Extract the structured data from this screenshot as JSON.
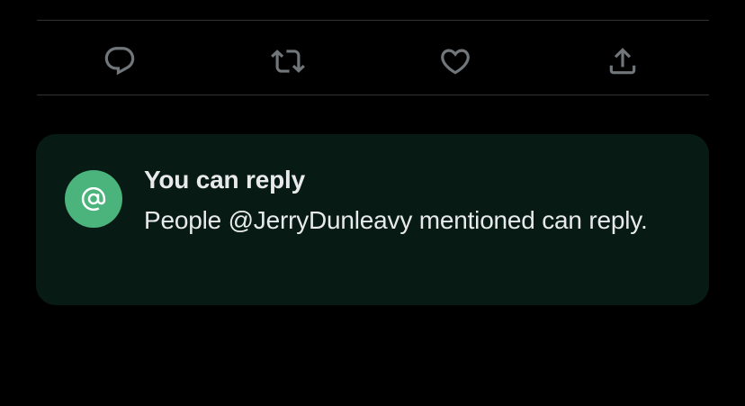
{
  "actions": {
    "reply_icon": "speech-bubble-icon",
    "retweet_icon": "retweet-icon",
    "like_icon": "heart-icon",
    "share_icon": "share-upload-icon"
  },
  "notice": {
    "icon": "at-sign-icon",
    "title": "You can reply",
    "body": "People @JerryDunleavy mentioned can reply.",
    "colors": {
      "card_background": "#071a14",
      "icon_background": "#4bb37c",
      "text": "#e7e9ea"
    }
  },
  "colors": {
    "background": "#000000",
    "divider": "#2f3336",
    "action_icon": "#71767b"
  }
}
